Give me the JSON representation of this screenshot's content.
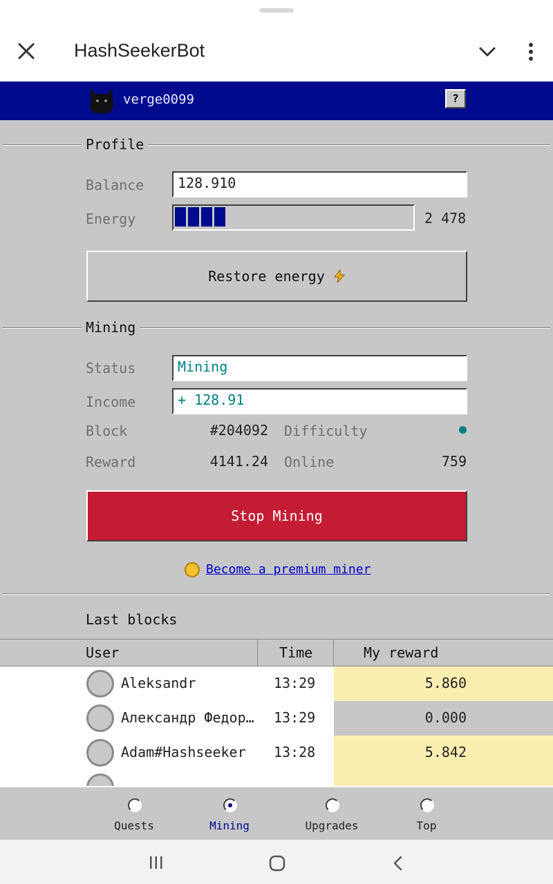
{
  "header": {
    "title": "HashSeekerBot"
  },
  "appbar": {
    "username": "verge0099",
    "help_label": "?"
  },
  "profile": {
    "section_label": "Profile",
    "balance_label": "Balance",
    "balance_value": "128.910",
    "energy_label": "Energy",
    "energy_value": "2 478",
    "energy_fraction": 0.23,
    "restore_label": "Restore energy",
    "restore_icon": "lightning-icon"
  },
  "mining": {
    "section_label": "Mining",
    "status_label": "Status",
    "status_value": "Mining",
    "income_label": "Income",
    "income_value": "+ 128.91",
    "block_label": "Block",
    "block_value": "#204092",
    "difficulty_label": "Difficulty",
    "reward_label": "Reward",
    "reward_value": "4141.24",
    "online_label": "Online",
    "online_value": "759",
    "stop_label": "Stop Mining",
    "premium_link": "Become a premium miner"
  },
  "blocks": {
    "title": "Last blocks",
    "columns": [
      "User",
      "Time",
      "My reward"
    ],
    "rows": [
      {
        "user": "Aleksandr",
        "time": "13:29",
        "reward": "5.860"
      },
      {
        "user": "Александр Федор…",
        "time": "13:29",
        "reward": "0.000"
      },
      {
        "user": "Adam#Hashseeker",
        "time": "13:28",
        "reward": "5.842"
      },
      {
        "user": "",
        "time": "",
        "reward": ""
      }
    ]
  },
  "nav": {
    "items": [
      {
        "label": "Quests"
      },
      {
        "label": "Mining"
      },
      {
        "label": "Upgrades"
      },
      {
        "label": "Top"
      }
    ]
  },
  "colors": {
    "appbar": "#000a8c",
    "stop": "#c41c34",
    "accent": "#008080",
    "link": "#0000cc",
    "reward_highlight": "#fbeeb1"
  }
}
